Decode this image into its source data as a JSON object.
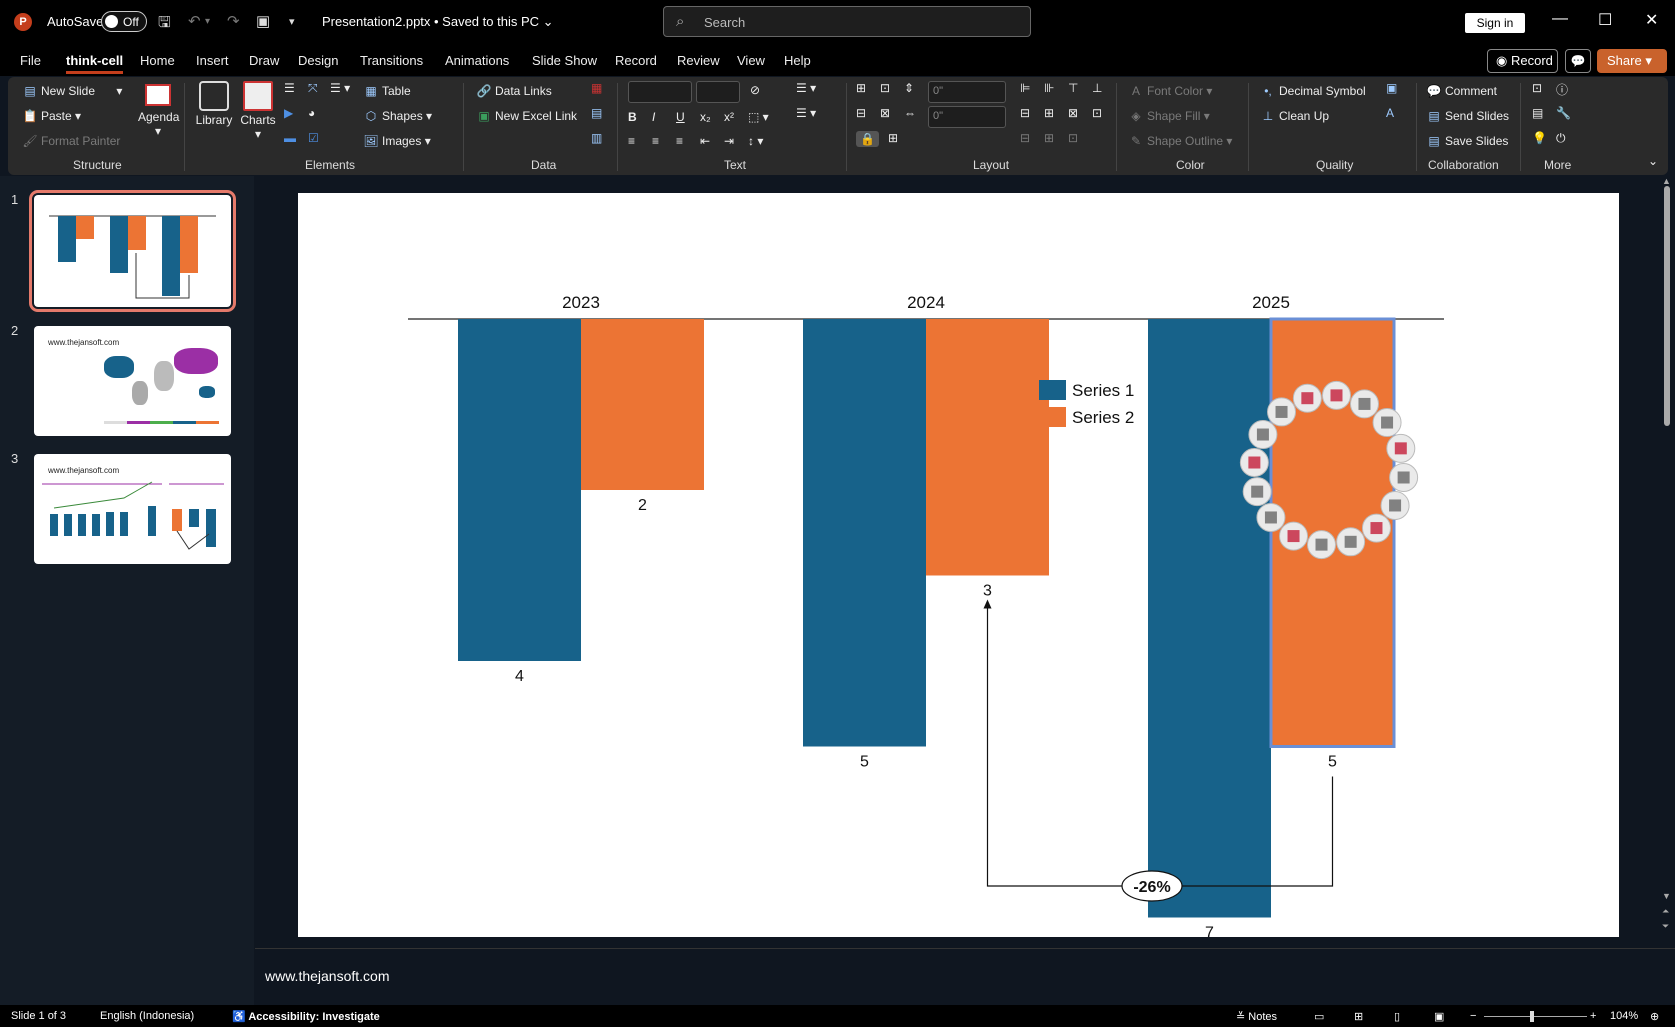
{
  "titlebar": {
    "autosave_label": "AutoSave",
    "autosave_state": "Off",
    "doc_title": "Presentation2.pptx • Saved to this PC",
    "search_placeholder": "Search",
    "sign_in": "Sign in"
  },
  "menu": {
    "tabs": [
      "File",
      "think-cell",
      "Home",
      "Insert",
      "Draw",
      "Design",
      "Transitions",
      "Animations",
      "Slide Show",
      "Record",
      "Review",
      "View",
      "Help"
    ],
    "active": "think-cell",
    "record_button": "Record",
    "share_button": "Share"
  },
  "ribbon": {
    "structure": {
      "new_slide": "New Slide",
      "paste": "Paste",
      "format_painter": "Format Painter",
      "agenda": "Agenda",
      "label": "Structure"
    },
    "elements": {
      "library": "Library",
      "charts": "Charts",
      "table": "Table",
      "shapes": "Shapes",
      "images": "Images",
      "label": "Elements"
    },
    "data": {
      "data_links": "Data Links",
      "new_excel_link": "New Excel Link",
      "label": "Data"
    },
    "text": {
      "label": "Text"
    },
    "layout": {
      "width_value": "0\"",
      "height_value": "0\"",
      "label": "Layout"
    },
    "color": {
      "font_color": "Font Color",
      "shape_fill": "Shape Fill",
      "shape_outline": "Shape Outline",
      "label": "Color"
    },
    "quality": {
      "decimal_symbol": "Decimal Symbol",
      "clean_up": "Clean Up",
      "label": "Quality"
    },
    "collaboration": {
      "comment": "Comment",
      "send_slides": "Send Slides",
      "save_slides": "Save Slides",
      "label": "Collaboration"
    },
    "more": {
      "label": "More"
    }
  },
  "thumbnails": {
    "numbers": [
      "1",
      "2",
      "3"
    ],
    "site_text": "www.thejansoft.com"
  },
  "chart_data": {
    "type": "bar",
    "categories": [
      "2023",
      "2024",
      "2025"
    ],
    "series": [
      {
        "name": "Series 1",
        "values": [
          4,
          5,
          7
        ],
        "color": "#17628a"
      },
      {
        "name": "Series 2",
        "values": [
          2,
          3,
          5
        ],
        "color": "#ec7434"
      }
    ],
    "orientation": "downward from top axis",
    "legend": {
      "position": "right",
      "entries": [
        "Series 1",
        "Series 2"
      ]
    },
    "annotation": {
      "type": "difference arrow",
      "label": "-26%",
      "from": "2025 Series 2",
      "to": "2024 Series 2"
    },
    "ylim": [
      0,
      7
    ]
  },
  "notes": {
    "text": "www.thejansoft.com"
  },
  "status": {
    "slide": "Slide 1 of 3",
    "language": "English (Indonesia)",
    "accessibility": "Accessibility: Investigate",
    "notes": "Notes",
    "zoom": "104%"
  },
  "colors": {
    "accent": "#c43e1c",
    "series1": "#17628a",
    "series2": "#ec7434",
    "selection": "#6a8fd6"
  }
}
